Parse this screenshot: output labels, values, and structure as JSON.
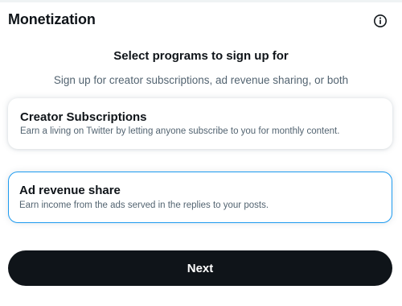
{
  "header": {
    "title": "Monetization",
    "info_icon": "info-circle-icon"
  },
  "intro": {
    "heading": "Select programs to sign up for",
    "subtitle": "Sign up for creator subscriptions, ad revenue sharing, or both"
  },
  "programs": [
    {
      "title": "Creator Subscriptions",
      "description": "Earn a living on Twitter by letting anyone subscribe to you for monthly content.",
      "selected": false
    },
    {
      "title": "Ad revenue share",
      "description": "Earn income from the ads served in the replies to your posts.",
      "selected": true
    }
  ],
  "footer": {
    "next_label": "Next"
  },
  "colors": {
    "text_primary": "#0f1419",
    "text_secondary": "#536471",
    "accent": "#1d9bf0",
    "button_bg": "#0f1419",
    "button_text": "#ffffff"
  }
}
